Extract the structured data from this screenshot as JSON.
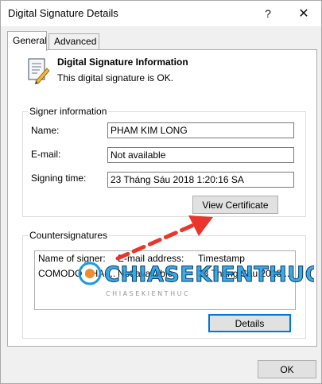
{
  "window": {
    "title": "Digital Signature Details",
    "help_label": "?",
    "close_label": "✕"
  },
  "tabs": [
    {
      "label": "General",
      "active": true
    },
    {
      "label": "Advanced",
      "active": false
    }
  ],
  "info": {
    "title": "Digital Signature Information",
    "status": "This digital signature is OK.",
    "icon": "certificate-document-icon"
  },
  "signer": {
    "group_label": "Signer information",
    "name_label": "Name:",
    "name_value": "PHAM KIM LONG",
    "email_label": "E-mail:",
    "email_value": "Not available",
    "time_label": "Signing time:",
    "time_value": "23 Tháng Sáu 2018 1:20:16 SA",
    "view_cert_label": "View Certificate"
  },
  "counter": {
    "group_label": "Countersignatures",
    "columns": [
      "Name of signer:",
      "E-mail address:",
      "Timestamp"
    ],
    "rows": [
      [
        "COMODO SHA-...",
        "Not available",
        "23 Tháng Sáu 2018 ..."
      ]
    ],
    "details_label": "Details"
  },
  "footer": {
    "ok_label": "OK"
  },
  "overlay": {
    "watermark_text": "CHIASEKIENTHUC",
    "watermark_sub": "C H I A   S E   K I E N   T H U C",
    "arrow_color": "#e8362a"
  }
}
